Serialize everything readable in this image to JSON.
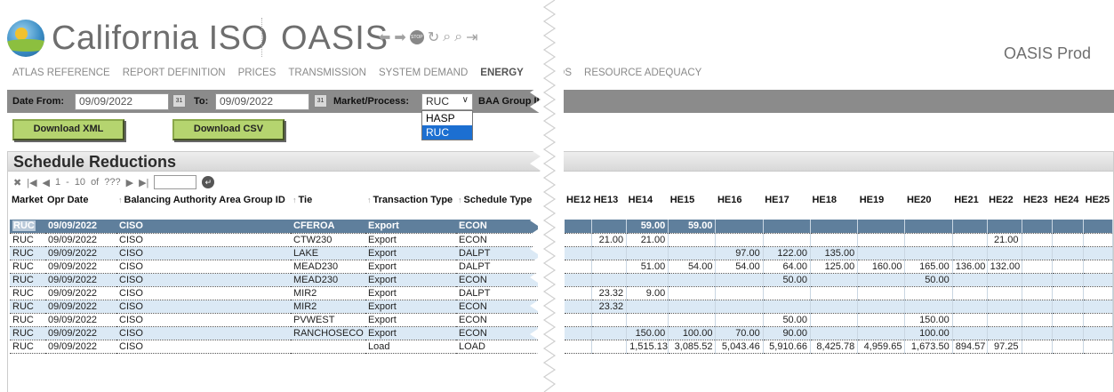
{
  "header": {
    "brand": "California ISO",
    "app_title": "OASIS",
    "environment": "OASIS Prod",
    "tool_icons": [
      "back-arrow-icon",
      "forward-arrow-icon",
      "stop-icon",
      "refresh-icon",
      "zoom-in-icon",
      "zoom-out-icon",
      "logout-icon"
    ],
    "stop_label": "STOP"
  },
  "nav": [
    {
      "label": "ATLAS REFERENCE",
      "active": false
    },
    {
      "label": "REPORT DEFINITION",
      "active": false
    },
    {
      "label": "PRICES",
      "active": false
    },
    {
      "label": "TRANSMISSION",
      "active": false
    },
    {
      "label": "SYSTEM DEMAND",
      "active": false
    },
    {
      "label": "ENERGY",
      "active": true
    },
    {
      "label": "'DS",
      "active": false
    },
    {
      "label": "RESOURCE ADEQUACY",
      "active": false
    }
  ],
  "filters": {
    "date_from_label": "Date From:",
    "date_from_value": "09/09/2022",
    "to_label": "To:",
    "to_value": "09/09/2022",
    "calendar_icon_text": "31",
    "market_label": "Market/Process:",
    "market_value": "RUC",
    "market_options": [
      "HASP",
      "RUC"
    ],
    "baa_label": "BAA Group ID"
  },
  "buttons": {
    "download_xml": "Download XML",
    "download_csv": "Download CSV"
  },
  "panel": {
    "title": "Schedule Reductions",
    "pager": {
      "first": "|◀",
      "prev": "◀",
      "range_start": "1",
      "dash": "-",
      "range_end": "10",
      "of": "of",
      "total": "???",
      "next": "▶",
      "last": "▶|",
      "go": "↵"
    }
  },
  "left_columns": [
    "Market",
    "Opr Date",
    "Balancing Authority Area Group ID",
    "Tie",
    "Transaction Type",
    "Schedule Type"
  ],
  "hour_columns": [
    "HE12",
    "HE13",
    "HE14",
    "HE15",
    "HE16",
    "HE17",
    "HE18",
    "HE19",
    "HE20",
    "HE21",
    "HE22",
    "HE23",
    "HE24",
    "HE25"
  ],
  "rows": [
    {
      "market": "RUC",
      "date": "09/09/2022",
      "baa": "CISO",
      "tie": "CFEROA",
      "ttype": "Export",
      "stype": "ECON",
      "he": [
        "",
        "",
        "59.00",
        "59.00",
        "",
        "",
        "",
        "",
        "",
        "",
        "",
        "",
        "",
        ""
      ]
    },
    {
      "market": "RUC",
      "date": "09/09/2022",
      "baa": "CISO",
      "tie": "CTW230",
      "ttype": "Export",
      "stype": "ECON",
      "he": [
        "",
        "21.00",
        "21.00",
        "",
        "",
        "",
        "",
        "",
        "",
        "",
        "21.00",
        "",
        "",
        ""
      ]
    },
    {
      "market": "RUC",
      "date": "09/09/2022",
      "baa": "CISO",
      "tie": "LAKE",
      "ttype": "Export",
      "stype": "DALPT",
      "he": [
        "",
        "",
        "",
        "",
        "97.00",
        "122.00",
        "135.00",
        "",
        "",
        "",
        "",
        "",
        "",
        ""
      ]
    },
    {
      "market": "RUC",
      "date": "09/09/2022",
      "baa": "CISO",
      "tie": "MEAD230",
      "ttype": "Export",
      "stype": "DALPT",
      "he": [
        "",
        "",
        "51.00",
        "54.00",
        "54.00",
        "64.00",
        "125.00",
        "160.00",
        "165.00",
        "136.00",
        "132.00",
        "",
        "",
        ""
      ]
    },
    {
      "market": "RUC",
      "date": "09/09/2022",
      "baa": "CISO",
      "tie": "MEAD230",
      "ttype": "Export",
      "stype": "ECON",
      "he": [
        "",
        "",
        "",
        "",
        "",
        "50.00",
        "",
        "",
        "50.00",
        "",
        "",
        "",
        "",
        ""
      ]
    },
    {
      "market": "RUC",
      "date": "09/09/2022",
      "baa": "CISO",
      "tie": "MIR2",
      "ttype": "Export",
      "stype": "DALPT",
      "he": [
        "",
        "23.32",
        "9.00",
        "",
        "",
        "",
        "",
        "",
        "",
        "",
        "",
        "",
        "",
        ""
      ]
    },
    {
      "market": "RUC",
      "date": "09/09/2022",
      "baa": "CISO",
      "tie": "MIR2",
      "ttype": "Export",
      "stype": "ECON",
      "he": [
        "",
        "23.32",
        "",
        "",
        "",
        "",
        "",
        "",
        "",
        "",
        "",
        "",
        "",
        ""
      ]
    },
    {
      "market": "RUC",
      "date": "09/09/2022",
      "baa": "CISO",
      "tie": "PVWEST",
      "ttype": "Export",
      "stype": "ECON",
      "he": [
        "",
        "",
        "",
        "",
        "",
        "50.00",
        "",
        "",
        "150.00",
        "",
        "",
        "",
        "",
        ""
      ]
    },
    {
      "market": "RUC",
      "date": "09/09/2022",
      "baa": "CISO",
      "tie": "RANCHOSECO",
      "ttype": "Export",
      "stype": "ECON",
      "he": [
        "",
        "",
        "150.00",
        "100.00",
        "70.00",
        "90.00",
        "",
        "",
        "100.00",
        "",
        "",
        "",
        "",
        ""
      ]
    },
    {
      "market": "RUC",
      "date": "09/09/2022",
      "baa": "CISO",
      "tie": "",
      "ttype": "Load",
      "stype": "LOAD",
      "he": [
        "",
        "",
        "1,515.13",
        "3,085.52",
        "5,043.46",
        "5,910.66",
        "8,425.78",
        "4,959.65",
        "1,673.50",
        "894.57",
        "97.25",
        "",
        "",
        ""
      ]
    }
  ],
  "colors": {
    "filter_bar": "#8b8b8b",
    "selected_row": "#5f7f9c",
    "alt_row": "#dbe9f5",
    "button_green": "#b5d46f",
    "dropdown_selected": "#1c6fd1"
  }
}
